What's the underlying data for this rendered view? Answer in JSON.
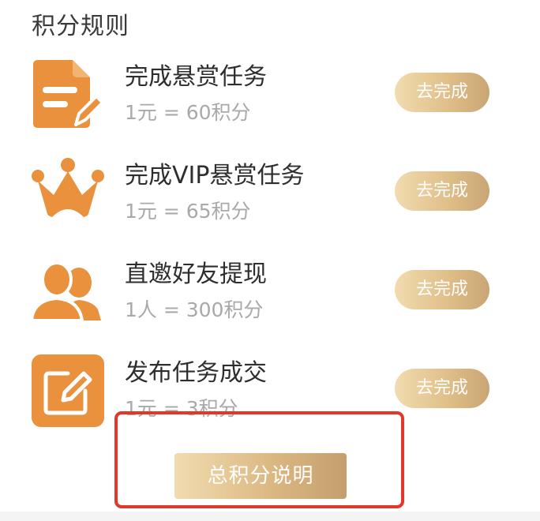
{
  "section": {
    "title": "积分规则"
  },
  "rules": [
    {
      "title": "完成悬赏任务",
      "rate": "1元 = 60积分",
      "action_label": "去完成",
      "icon": "document-edit-icon"
    },
    {
      "title": "完成VIP悬赏任务",
      "rate": "1元 = 65积分",
      "action_label": "去完成",
      "icon": "crown-icon"
    },
    {
      "title": "直邀好友提现",
      "rate": "1人 = 300积分",
      "action_label": "去完成",
      "icon": "users-icon"
    },
    {
      "title": "发布任务成交",
      "rate": "1元 = 3积分",
      "action_label": "去完成",
      "icon": "edit-square-icon"
    }
  ],
  "footer": {
    "total_button_label": "总积分说明"
  },
  "colors": {
    "icon_orange": "#e9913c",
    "button_gold_start": "#f1dcb0",
    "button_gold_end": "#c9a574",
    "highlight_red": "#e2382c",
    "rate_gray": "#a9a9a9"
  }
}
